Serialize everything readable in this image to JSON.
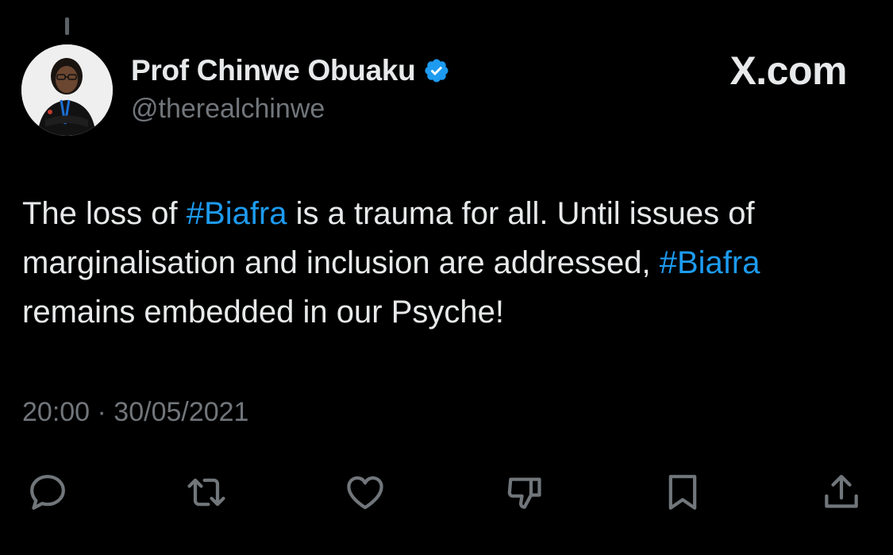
{
  "author": {
    "display_name": "Prof Chinwe Obuaku",
    "handle": "@therealchinwe",
    "verified_color": "#1d9bf0"
  },
  "brand": {
    "label": "X.com"
  },
  "tweet": {
    "line1": {
      "pre": "The loss of ",
      "tag": "#Biafra",
      "post": " is a trauma for all. Until issues of"
    },
    "line2": {
      "pre": "marginalisation and inclusion are addressed, ",
      "tag": "#Biafra"
    },
    "line3": {
      "text": "remains embedded in our Psyche!"
    },
    "hashtag_color": "#1d9bf0"
  },
  "timestamp": "20:00 · 30/05/2021",
  "actions": [
    {
      "icon": "reply-icon"
    },
    {
      "icon": "retweet-icon"
    },
    {
      "icon": "like-icon"
    },
    {
      "icon": "dislike-icon"
    },
    {
      "icon": "bookmark-icon"
    },
    {
      "icon": "share-icon"
    }
  ]
}
